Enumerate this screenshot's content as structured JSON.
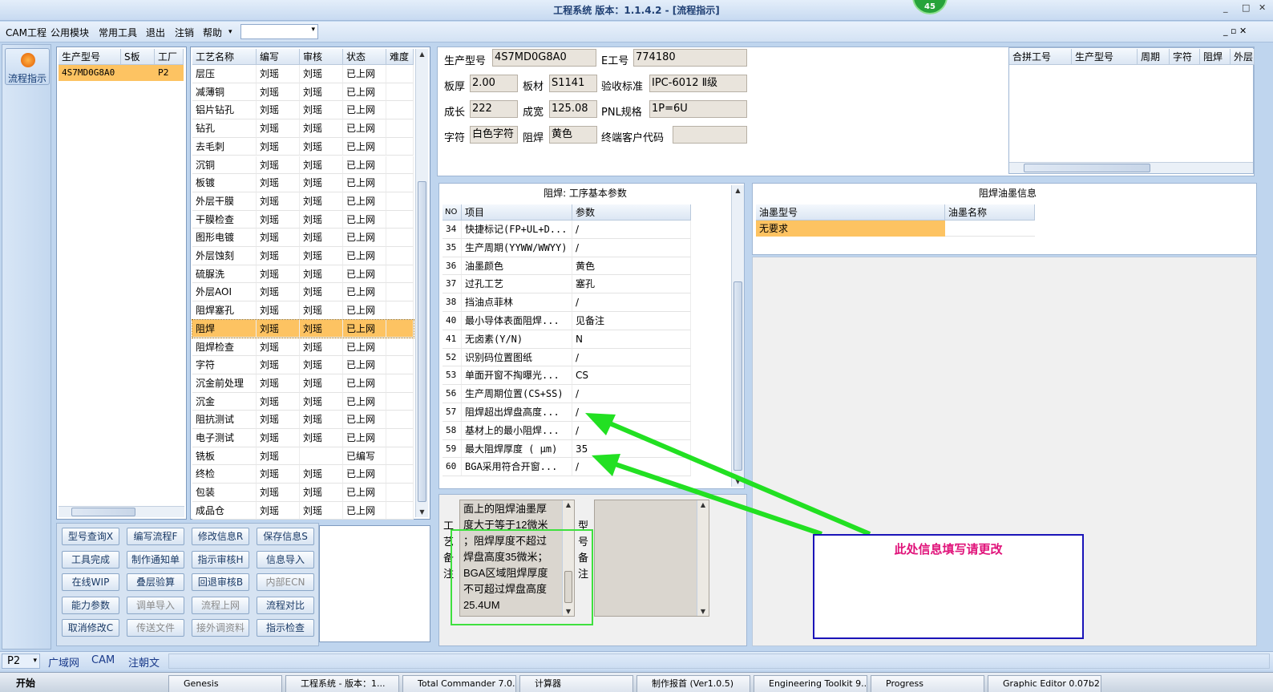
{
  "window": {
    "title": "工程系统   版本：1.1.4.2 - [流程指示]",
    "badge": "45",
    "minimize": "_",
    "maximize": "□",
    "close": "✕"
  },
  "menu": {
    "items": [
      "CAM工程",
      "公用模块",
      "常用工具",
      "退出",
      "注销",
      "帮助"
    ],
    "dropdown_arrow": "▾",
    "mdi_controls": "_ ▫ ✕"
  },
  "nav": {
    "flow_button": "流程指示"
  },
  "model_list": {
    "headers": [
      "生产型号",
      "S板",
      "工厂"
    ],
    "rows": [
      [
        "4S7MD0G8A0",
        "",
        "P2"
      ]
    ]
  },
  "process_table": {
    "headers": [
      "工艺名称",
      "编写",
      "审核",
      "状态",
      "难度"
    ],
    "rows": [
      [
        "层压",
        "刘瑶",
        "刘瑶",
        "已上网",
        ""
      ],
      [
        "减薄铜",
        "刘瑶",
        "刘瑶",
        "已上网",
        ""
      ],
      [
        "铝片钻孔",
        "刘瑶",
        "刘瑶",
        "已上网",
        ""
      ],
      [
        "钻孔",
        "刘瑶",
        "刘瑶",
        "已上网",
        ""
      ],
      [
        "去毛刺",
        "刘瑶",
        "刘瑶",
        "已上网",
        ""
      ],
      [
        "沉铜",
        "刘瑶",
        "刘瑶",
        "已上网",
        ""
      ],
      [
        "板镀",
        "刘瑶",
        "刘瑶",
        "已上网",
        ""
      ],
      [
        "外层干膜",
        "刘瑶",
        "刘瑶",
        "已上网",
        ""
      ],
      [
        "干膜检查",
        "刘瑶",
        "刘瑶",
        "已上网",
        ""
      ],
      [
        "图形电镀",
        "刘瑶",
        "刘瑶",
        "已上网",
        ""
      ],
      [
        "外层蚀刻",
        "刘瑶",
        "刘瑶",
        "已上网",
        ""
      ],
      [
        "硫脲洗",
        "刘瑶",
        "刘瑶",
        "已上网",
        ""
      ],
      [
        "外层AOI",
        "刘瑶",
        "刘瑶",
        "已上网",
        ""
      ],
      [
        "阻焊塞孔",
        "刘瑶",
        "刘瑶",
        "已上网",
        ""
      ],
      [
        "阻焊",
        "刘瑶",
        "刘瑶",
        "已上网",
        ""
      ],
      [
        "阻焊检查",
        "刘瑶",
        "刘瑶",
        "已上网",
        ""
      ],
      [
        "字符",
        "刘瑶",
        "刘瑶",
        "已上网",
        ""
      ],
      [
        "沉金前处理",
        "刘瑶",
        "刘瑶",
        "已上网",
        ""
      ],
      [
        "沉金",
        "刘瑶",
        "刘瑶",
        "已上网",
        ""
      ],
      [
        "阻抗测试",
        "刘瑶",
        "刘瑶",
        "已上网",
        ""
      ],
      [
        "电子测试",
        "刘瑶",
        "刘瑶",
        "已上网",
        ""
      ],
      [
        "铣板",
        "刘瑶",
        "",
        "已编写",
        ""
      ],
      [
        "终检",
        "刘瑶",
        "刘瑶",
        "已上网",
        ""
      ],
      [
        "包装",
        "刘瑶",
        "刘瑶",
        "已上网",
        ""
      ],
      [
        "成品仓",
        "刘瑶",
        "刘瑶",
        "已上网",
        ""
      ]
    ],
    "selected_index": 14
  },
  "buttons": [
    [
      "型号查询X",
      "编写流程F",
      "修改信息R",
      "保存信息S"
    ],
    [
      "工具完成",
      "制作通知单",
      "指示审核H",
      "信息导入"
    ],
    [
      "在线WIP",
      "叠层验算",
      "回退审核B",
      "内部ECN"
    ],
    [
      "能力参数",
      "调单导入",
      "流程上网",
      "流程对比"
    ],
    [
      "取消修改C",
      "传送文件",
      "接外调资料",
      "指示检查"
    ]
  ],
  "disabled_buttons": [
    "内部ECN",
    "调单导入",
    "流程上网",
    "传送文件",
    "接外调资料"
  ],
  "info": {
    "labels": {
      "model": "生产型号",
      "eno": "E工号",
      "thickness": "板厚",
      "material": "板材",
      "standard": "验收标准",
      "length": "成长",
      "width": "成宽",
      "pnl": "PNL规格",
      "char": "字符",
      "mask": "阻焊",
      "endcode": "终端客户代码"
    },
    "values": {
      "model": "4S7MD0G8A0",
      "eno": "774180",
      "thickness": "2.00",
      "material": "S1141",
      "standard": "IPC-6012 Ⅱ级",
      "length": "222",
      "width": "125.08",
      "pnl": "1P=6U",
      "char": "白色字符",
      "mask": "黄色",
      "endcode": ""
    }
  },
  "merge_table": {
    "headers": [
      "合拼工号",
      "生产型号",
      "周期",
      "字符",
      "阻焊",
      "外层"
    ]
  },
  "params": {
    "title": "阻焊: 工序基本参数",
    "headers": [
      "NO",
      "项目",
      "参数"
    ],
    "rows": [
      [
        "34",
        "快捷标记(FP+UL+D...",
        "/"
      ],
      [
        "35",
        "生产周期(YYWW/WWYY)",
        "/"
      ],
      [
        "36",
        "油墨颜色",
        "黄色"
      ],
      [
        "37",
        "过孔工艺",
        "塞孔"
      ],
      [
        "38",
        "挡油点菲林",
        "/"
      ],
      [
        "40",
        "最小导体表面阻焊...",
        "见备注"
      ],
      [
        "41",
        "无卤素(Y/N)",
        "N"
      ],
      [
        "52",
        "识别码位置图纸",
        "/"
      ],
      [
        "53",
        "单面开窗不掏曝光...",
        "CS"
      ],
      [
        "56",
        "生产周期位置(CS+SS)",
        "/"
      ],
      [
        "57",
        "阻焊超出焊盘高度...",
        "/"
      ],
      [
        "58",
        "基材上的最小阻焊...",
        "/"
      ],
      [
        "59",
        "最大阻焊厚度 ( μm)",
        "35"
      ],
      [
        "60",
        "BGA采用符合开窗...",
        "/"
      ]
    ]
  },
  "ink": {
    "title": "阻焊油墨信息",
    "headers": [
      "油墨型号",
      "油墨名称"
    ],
    "rows": [
      [
        "无要求",
        ""
      ]
    ]
  },
  "remarks": {
    "process_label": "工艺备注",
    "model_label": "型号备注",
    "process_text": [
      "面上的阻焊油墨厚",
      "度大于等于12微米",
      "；阻焊厚度不超过",
      "焊盘高度35微米；",
      "BGA区域阻焊厚度",
      "不可超过焊盘高度",
      "25.4UM"
    ]
  },
  "annotation": {
    "text": "此处信息填写请更改",
    "arrow_color": "#22e022",
    "box_color": "#1a14b8",
    "text_color": "#e0137a"
  },
  "statusbar": {
    "factory": "P2",
    "tabs": [
      "广域网",
      "CAM",
      "注朝文"
    ]
  },
  "taskbar": {
    "start": "开始",
    "tasks": [
      "Genesis",
      "工程系统 - 版本：1...",
      "Total Commander 7.0...",
      "计算器",
      "制作报首 (Ver1.0.5)",
      "Engineering Toolkit 9...",
      "Progress",
      "Graphic Editor 0.07b2"
    ]
  }
}
